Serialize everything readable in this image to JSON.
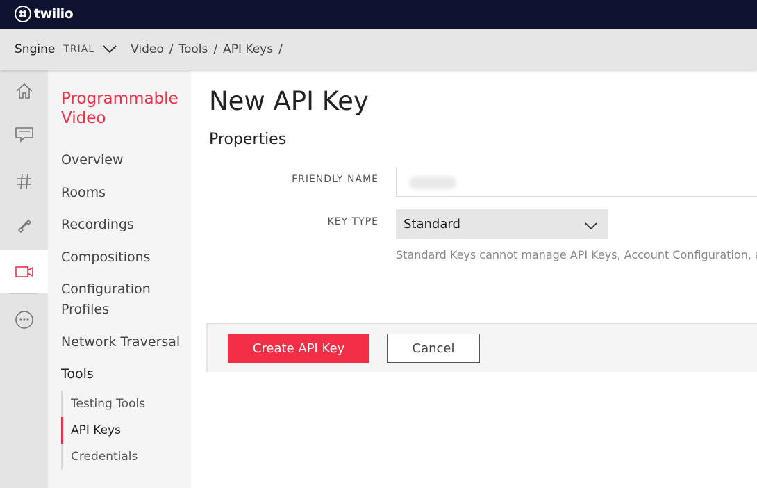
{
  "brand": {
    "name": "twilio",
    "accent": "#f22f46",
    "topbar_color": "#0d1330"
  },
  "breadcrumb": {
    "project": "Sngine",
    "badge": "TRIAL",
    "items": [
      "Video",
      "Tools",
      "API Keys"
    ],
    "separator": "/"
  },
  "icon_rail": [
    {
      "icon": "home-icon"
    },
    {
      "icon": "chat-icon"
    },
    {
      "icon": "hash-icon"
    },
    {
      "icon": "phone-icon"
    },
    {
      "icon": "video-icon",
      "active": true
    },
    {
      "icon": "more-icon"
    }
  ],
  "sidenav": {
    "title": "Programmable Video",
    "items": [
      "Overview",
      "Rooms",
      "Recordings",
      "Compositions",
      "Configuration Profiles",
      "Network Traversal",
      "Tools"
    ],
    "sub_items": [
      "Testing Tools",
      "API Keys",
      "Credentials"
    ],
    "active_sub": "API Keys"
  },
  "main": {
    "title": "New API Key",
    "section": "Properties",
    "friendly_name_label": "FRIENDLY NAME",
    "key_type_label": "KEY TYPE",
    "key_type_value": "Standard",
    "hint": "Standard Keys cannot manage API Keys, Account Configuration, and",
    "create_label": "Create API Key",
    "cancel_label": "Cancel"
  }
}
